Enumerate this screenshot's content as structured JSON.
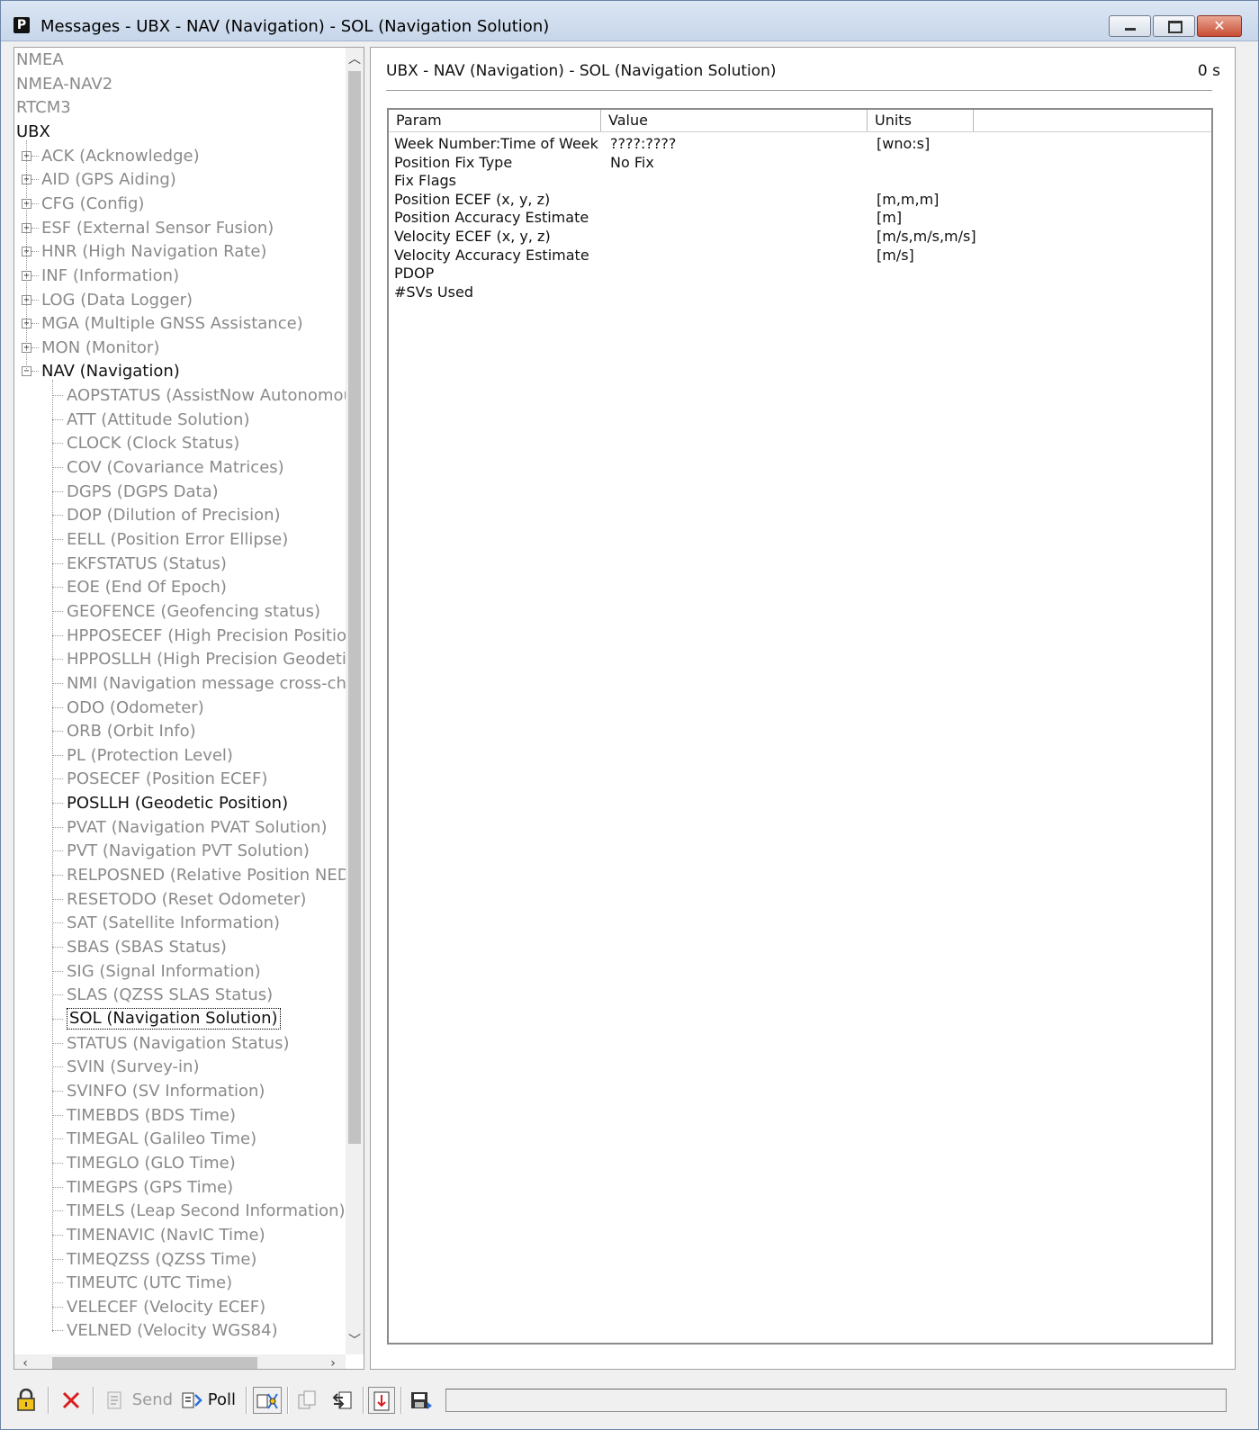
{
  "window": {
    "title": "Messages - UBX - NAV (Navigation) - SOL (Navigation Solution)",
    "app_icon_letter": "P"
  },
  "tree": {
    "top_items": [
      "NMEA",
      "NMEA-NAV2",
      "RTCM3",
      "UBX"
    ],
    "ubx_classes": [
      "ACK (Acknowledge)",
      "AID (GPS Aiding)",
      "CFG (Config)",
      "ESF (External Sensor Fusion)",
      "HNR (High Navigation Rate)",
      "INF (Information)",
      "LOG (Data Logger)",
      "MGA (Multiple GNSS Assistance)",
      "MON (Monitor)",
      "NAV (Navigation)"
    ],
    "nav_messages": [
      "AOPSTATUS (AssistNow Autonomous",
      "ATT (Attitude Solution)",
      "CLOCK (Clock Status)",
      "COV (Covariance Matrices)",
      "DGPS (DGPS Data)",
      "DOP (Dilution of Precision)",
      "EELL (Position Error Ellipse)",
      "EKFSTATUS (Status)",
      "EOE (End Of Epoch)",
      "GEOFENCE (Geofencing status)",
      "HPPOSECEF (High Precision Position E",
      "HPPOSLLH (High Precision Geodetic P",
      "NMI (Navigation message cross-check",
      "ODO (Odometer)",
      "ORB (Orbit Info)",
      "PL (Protection Level)",
      "POSECEF (Position ECEF)",
      "POSLLH (Geodetic Position)",
      "PVAT (Navigation PVAT Solution)",
      "PVT (Navigation PVT Solution)",
      "RELPOSNED (Relative Position NED)",
      "RESETODO (Reset Odometer)",
      "SAT (Satellite Information)",
      "SBAS (SBAS Status)",
      "SIG (Signal Information)",
      "SLAS (QZSS SLAS Status)",
      "SOL (Navigation Solution)",
      "STATUS (Navigation Status)",
      "SVIN (Survey-in)",
      "SVINFO (SV Information)",
      "TIMEBDS (BDS Time)",
      "TIMEGAL (Galileo Time)",
      "TIMEGLO (GLO Time)",
      "TIMEGPS (GPS Time)",
      "TIMELS (Leap Second Information)",
      "TIMENAVIC (NavIC Time)",
      "TIMEQZSS (QZSS Time)",
      "TIMEUTC (UTC Time)",
      "VELECEF (Velocity ECEF)",
      "VELNED (Velocity WGS84)"
    ],
    "selected": "SOL (Navigation Solution)",
    "active_items": [
      "UBX",
      "NAV (Navigation)",
      "POSLLH (Geodetic Position)",
      "SOL (Navigation Solution)"
    ]
  },
  "detail": {
    "header": "UBX - NAV (Navigation) - SOL (Navigation Solution)",
    "age": "0 s",
    "columns": [
      "Param",
      "Value",
      "Units"
    ],
    "rows": [
      {
        "param": "Week Number:Time of Week",
        "value": "????:????",
        "units": "[wno:s]"
      },
      {
        "param": "Position Fix Type",
        "value": "No Fix",
        "units": ""
      },
      {
        "param": "Fix Flags",
        "value": "",
        "units": ""
      },
      {
        "param": "Position ECEF (x, y, z)",
        "value": "",
        "units": "[m,m,m]"
      },
      {
        "param": "Position Accuracy Estimate",
        "value": "",
        "units": "[m]"
      },
      {
        "param": "Velocity ECEF (x, y, z)",
        "value": "",
        "units": "[m/s,m/s,m/s]"
      },
      {
        "param": "Velocity Accuracy Estimate",
        "value": "",
        "units": "[m/s]"
      },
      {
        "param": "PDOP",
        "value": "",
        "units": ""
      },
      {
        "param": "#SVs Used",
        "value": "",
        "units": ""
      }
    ]
  },
  "toolbar": {
    "send_label": "Send",
    "poll_label": "Poll"
  },
  "colors": {
    "inactive_text": "#8a8a8a",
    "active_text": "#111111",
    "close_button": "#c94d35",
    "title_bar": "#c7d6ea"
  }
}
